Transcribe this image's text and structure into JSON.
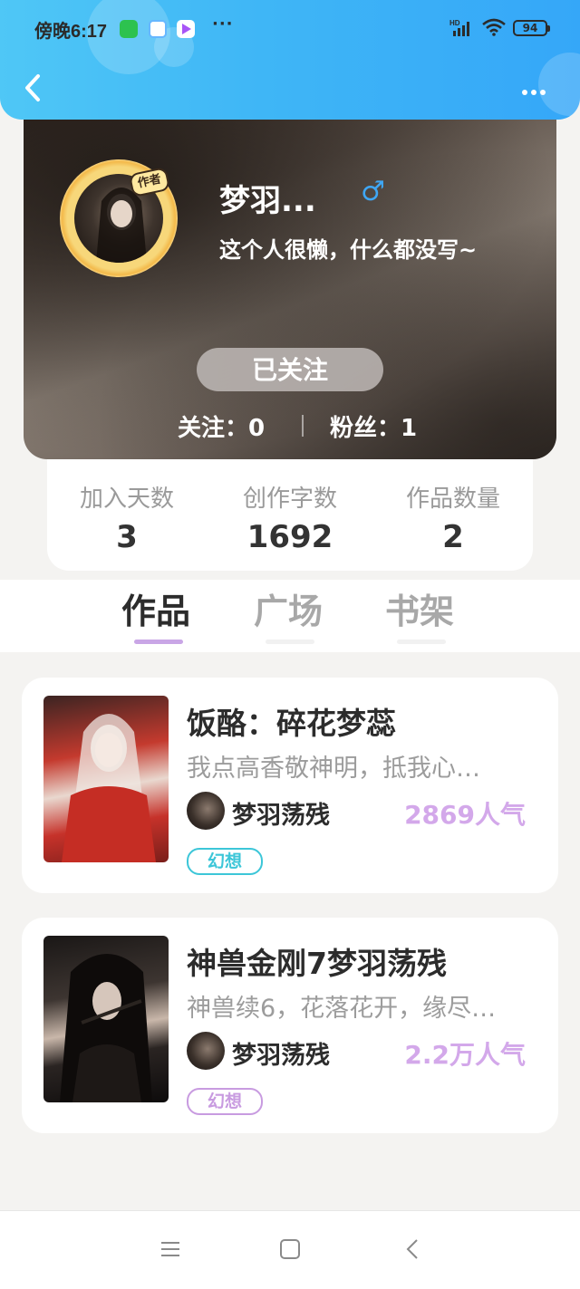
{
  "status_bar": {
    "time": "傍晚6:17",
    "more_indicator": "···",
    "network": "HD",
    "battery": "94"
  },
  "header": {
    "back_icon": "chevron-left-icon",
    "more_icon": "more-dots-icon"
  },
  "profile": {
    "badge": "作者",
    "name": "梦羽...",
    "gender_symbol": "♂",
    "bio": "这个人很懒，什么都没写~",
    "follow_button": "已关注",
    "following": "关注：0",
    "followers": "粉丝：1"
  },
  "stats": [
    {
      "label": "加入天数",
      "value": "3"
    },
    {
      "label": "创作字数",
      "value": "1692"
    },
    {
      "label": "作品数量",
      "value": "2"
    }
  ],
  "tabs": [
    {
      "label": "作品",
      "active": true
    },
    {
      "label": "广场",
      "active": false
    },
    {
      "label": "书架",
      "active": false
    }
  ],
  "works": [
    {
      "title": "饭酪：碎花梦蕊",
      "description": "我点高香敬神明，抵我心…",
      "author": "梦羽荡残",
      "popularity": "2869人气",
      "genre": "幻想",
      "genre_color": "#3cc6d8"
    },
    {
      "title": "神兽金刚7梦羽荡残",
      "description": "神兽续6，花落花开，缘尽…",
      "author": "梦羽荡残",
      "popularity": "2.2万人气",
      "genre": "幻想",
      "genre_color": "#c89be0"
    }
  ],
  "colors": {
    "header_gradient_start": "#4fc7f6",
    "header_gradient_end": "#35a7f8",
    "popularity": "#d3a8ea",
    "tab_indicator_active": "#c9a6e6"
  },
  "nav_bar": {
    "menu_icon": "menu-lines-icon",
    "home_icon": "square-home-icon",
    "back_icon": "triangle-back-icon"
  }
}
